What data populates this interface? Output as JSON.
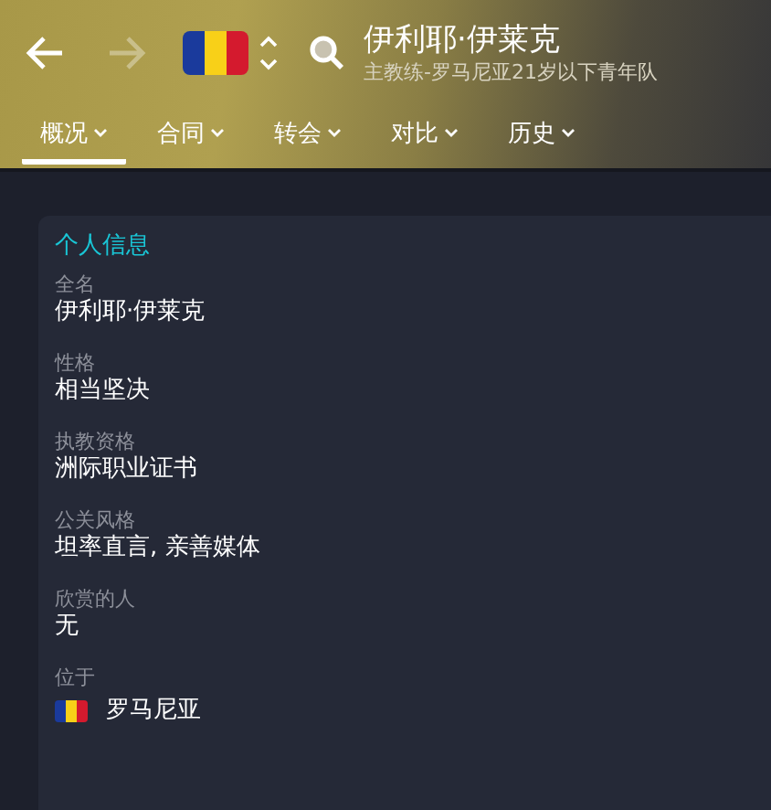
{
  "header": {
    "back": {
      "disabled": false
    },
    "forward": {
      "disabled": true
    },
    "title": "伊利耶·伊莱克",
    "subtitle": "主教练-罗马尼亚21岁以下青年队"
  },
  "tabs": [
    {
      "label": "概况",
      "selected": true
    },
    {
      "label": "合同",
      "selected": false
    },
    {
      "label": "转会",
      "selected": false
    },
    {
      "label": "对比",
      "selected": false
    },
    {
      "label": "历史",
      "selected": false
    }
  ],
  "card": {
    "title": "个人信息",
    "fields": [
      {
        "label": "全名",
        "value": "伊利耶·伊莱克",
        "kind": "text"
      },
      {
        "label": "性格",
        "value": "相当坚决",
        "kind": "text"
      },
      {
        "label": "执教资格",
        "value": "洲际职业证书",
        "kind": "text"
      },
      {
        "label": "公关风格",
        "value": "坦率直言, 亲善媒体",
        "kind": "text"
      },
      {
        "label": "欣赏的人",
        "value": "无",
        "kind": "text"
      },
      {
        "label": "位于",
        "value": "罗马尼亚",
        "kind": "flag"
      }
    ]
  }
}
